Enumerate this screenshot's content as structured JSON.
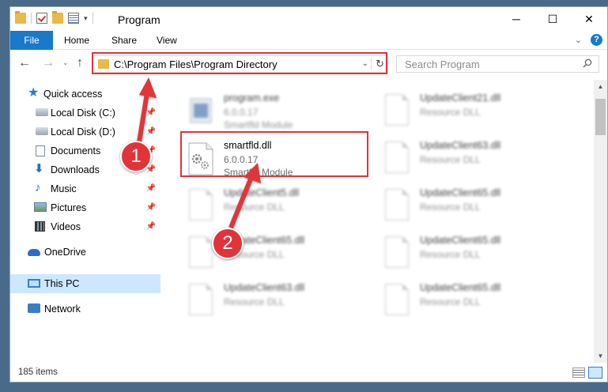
{
  "window": {
    "title": "Program",
    "controls": {
      "minimize": "─",
      "maximize": "☐",
      "close": "✕"
    }
  },
  "ribbon": {
    "tabs": [
      {
        "label": "File"
      },
      {
        "label": "Home"
      },
      {
        "label": "Share"
      },
      {
        "label": "View"
      }
    ],
    "help": "?",
    "expand": "⌄"
  },
  "address": {
    "path": "C:\\Program Files\\Program Directory",
    "back": "←",
    "forward": "→",
    "up": "↑",
    "recent": "⌄",
    "dropdown": "⌄",
    "refresh": "↻"
  },
  "search": {
    "placeholder": "Search Program"
  },
  "sidebar": {
    "items": [
      {
        "label": "Quick access",
        "icon": "star-icon"
      },
      {
        "label": "Local Disk (C:)",
        "icon": "disk-icon",
        "pinned": true
      },
      {
        "label": "Local Disk (D:)",
        "icon": "disk-icon",
        "pinned": true
      },
      {
        "label": "Documents",
        "icon": "documents-icon",
        "pinned": true
      },
      {
        "label": "Downloads",
        "icon": "downloads-icon",
        "pinned": true
      },
      {
        "label": "Music",
        "icon": "music-icon",
        "pinned": true
      },
      {
        "label": "Pictures",
        "icon": "pictures-icon",
        "pinned": true
      },
      {
        "label": "Videos",
        "icon": "videos-icon",
        "pinned": true
      },
      {
        "label": "OneDrive",
        "icon": "cloud-icon"
      },
      {
        "label": "This PC",
        "icon": "computer-icon",
        "selected": true
      },
      {
        "label": "Network",
        "icon": "network-icon"
      }
    ]
  },
  "files": [
    {
      "name": "program.exe",
      "line2": "6.0.0.17",
      "line3": "Smartfld Module"
    },
    {
      "name": "UpdateClient21.dll",
      "line2": "Resource DLL",
      "line3": ""
    },
    {
      "name": "smartfld.dll",
      "line2": "6.0.0.17",
      "line3": "Smartfld Module"
    },
    {
      "name": "UpdateClient63.dll",
      "line2": "Resource DLL",
      "line3": ""
    },
    {
      "name": "UpdateClient5.dll",
      "line2": "Resource DLL",
      "line3": ""
    },
    {
      "name": "UpdateClient65.dll",
      "line2": "Resource DLL",
      "line3": ""
    },
    {
      "name": "UpdateClient65.dll",
      "line2": "Resource DLL",
      "line3": ""
    },
    {
      "name": "UpdateClient65.dll",
      "line2": "Resource DLL",
      "line3": ""
    },
    {
      "name": "UpdateClient63.dll",
      "line2": "Resource DLL",
      "line3": ""
    },
    {
      "name": "UpdateClient65.dll",
      "line2": "Resource DLL",
      "line3": ""
    }
  ],
  "status": {
    "count": "185 items"
  },
  "annotations": {
    "steps": [
      "1",
      "2"
    ],
    "color": "#e0343a"
  },
  "colors": {
    "accent": "#1979ca",
    "selection": "#cce8ff",
    "highlight": "#e0343a"
  }
}
